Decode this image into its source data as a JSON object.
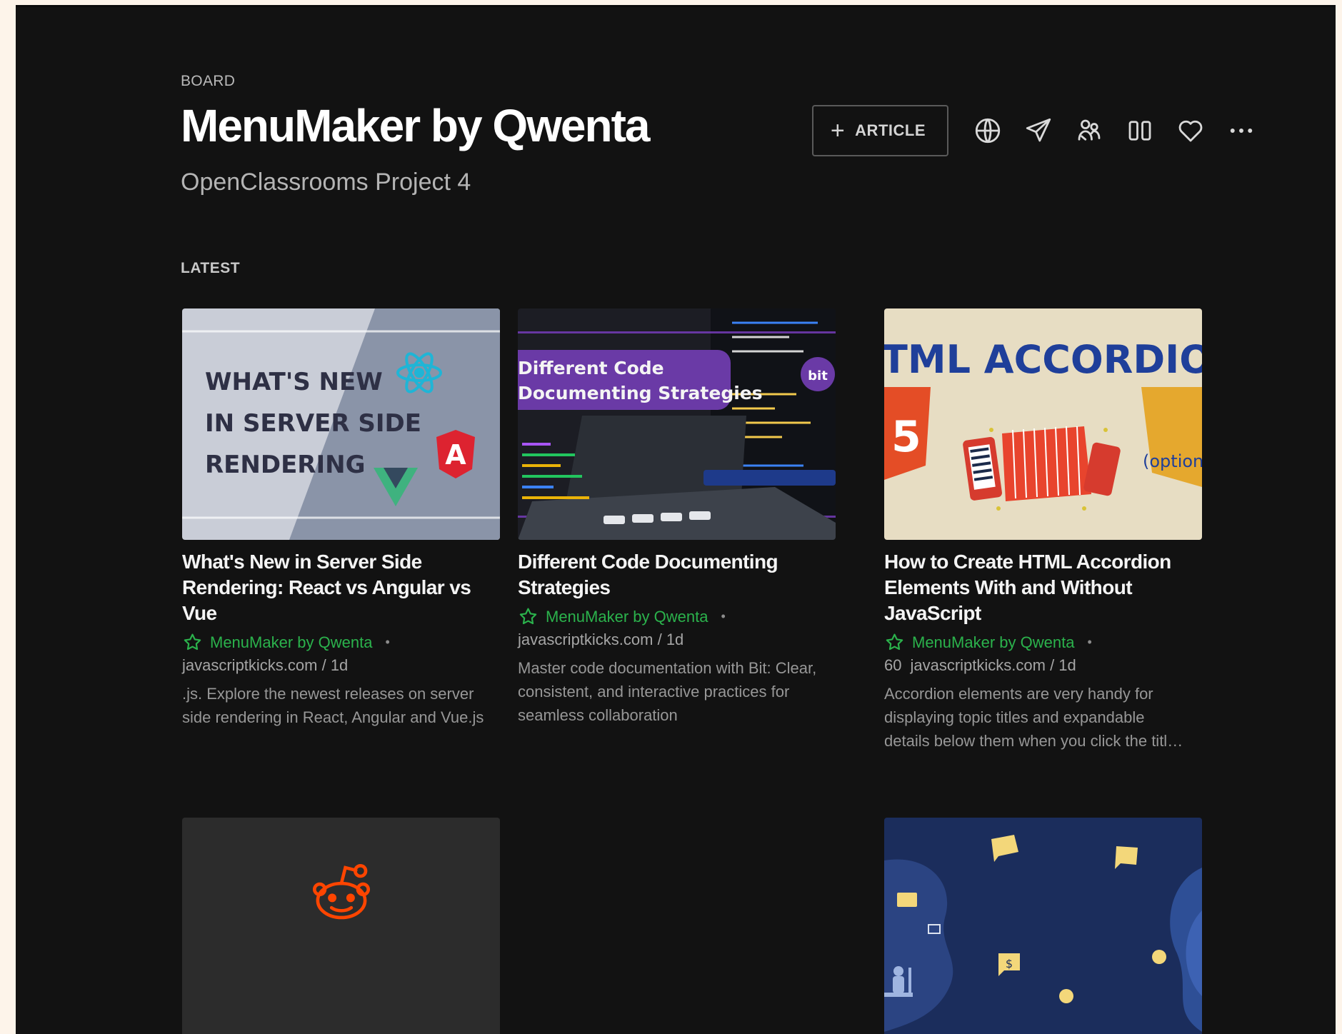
{
  "header": {
    "eyebrow": "BOARD",
    "title": "MenuMaker by Qwenta",
    "subtitle": "OpenClassrooms Project 4",
    "add_article_label": "ARTICLE",
    "icons": [
      "globe-icon",
      "send-icon",
      "people-icon",
      "columns-icon",
      "heart-icon",
      "more-icon"
    ]
  },
  "section": {
    "label": "LATEST"
  },
  "colors": {
    "background": "#121212",
    "accent_green": "#2bb24c",
    "page_edge": "#fdf4ea",
    "reddit_orange": "#ff4500"
  },
  "cards": [
    {
      "title": "What's New in Server Side Rendering: React vs Angular vs Vue",
      "board": "MenuMaker by Qwenta",
      "source": "javascriptkicks.com / 1d",
      "excerpt": ".js. Explore the newest releases on server side rendering in React, Angular and Vue.js",
      "thumb_text": [
        "WHAT'S NEW",
        "IN SERVER SIDE",
        "RENDERING"
      ],
      "thumb_letter": "A"
    },
    {
      "title": "Different Code Documenting Strategies",
      "board": "MenuMaker by Qwenta",
      "source": "javascriptkicks.com / 1d",
      "excerpt": "Master code documentation with Bit: Clear, consistent, and interactive practices for seamless collaboration",
      "thumb_text": [
        "Different Code",
        "Documenting Strategies"
      ],
      "thumb_badge": "bit"
    },
    {
      "title": "How to Create HTML Accordion Elements With and Without JavaScript",
      "board": "MenuMaker by Qwenta",
      "count": "60",
      "source": "javascriptkicks.com / 1d",
      "excerpt_lines": [
        "Accordion elements are very handy for",
        "displaying topic titles and expandable",
        "details below them when you click the titl…"
      ],
      "thumb_text": "TML ACCORDION",
      "thumb_note": "(option",
      "thumb_badge": "5"
    }
  ],
  "bottom_row": {
    "dollar_sign": "$"
  }
}
